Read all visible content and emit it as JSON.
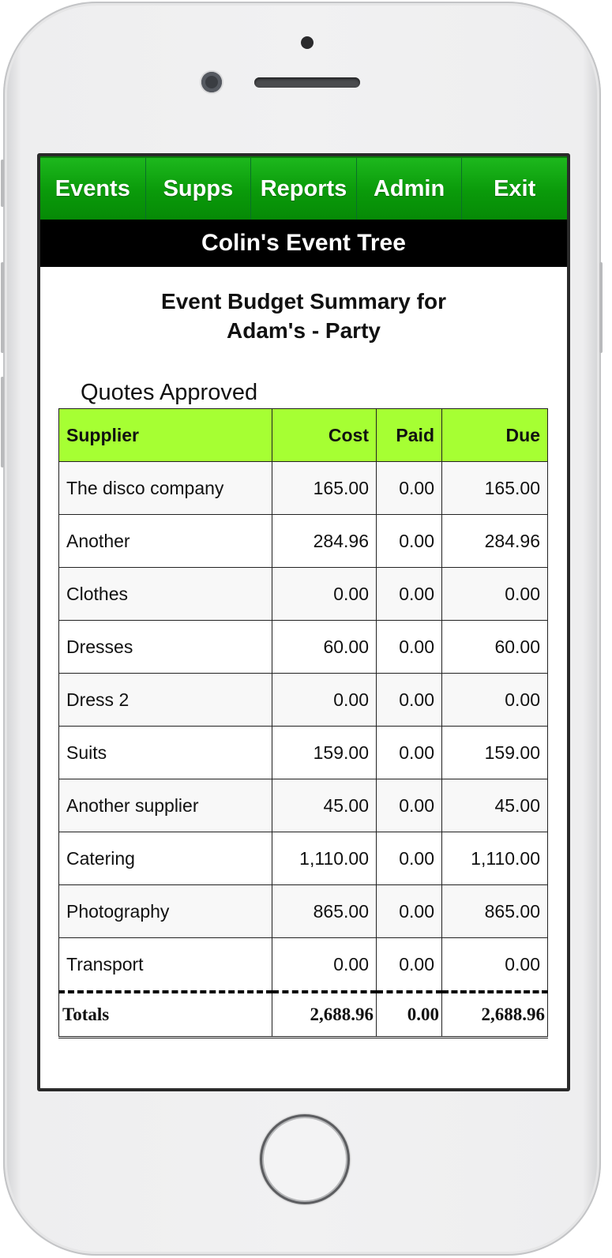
{
  "nav": {
    "items": [
      "Events",
      "Supps",
      "Reports",
      "Admin",
      "Exit"
    ]
  },
  "app_title": "Colin's Event Tree",
  "heading": {
    "line1": "Event Budget Summary for",
    "line2": "Adam's - Party"
  },
  "section_label": "Quotes Approved",
  "table": {
    "headers": [
      "Supplier",
      "Cost",
      "Paid",
      "Due"
    ],
    "rows": [
      [
        "The disco company",
        "165.00",
        "0.00",
        "165.00"
      ],
      [
        "Another",
        "284.96",
        "0.00",
        "284.96"
      ],
      [
        "Clothes",
        "0.00",
        "0.00",
        "0.00"
      ],
      [
        "Dresses",
        "60.00",
        "0.00",
        "60.00"
      ],
      [
        "Dress 2",
        "0.00",
        "0.00",
        "0.00"
      ],
      [
        "Suits",
        "159.00",
        "0.00",
        "159.00"
      ],
      [
        "Another supplier",
        "45.00",
        "0.00",
        "45.00"
      ],
      [
        "Catering",
        "1,110.00",
        "0.00",
        "1,110.00"
      ],
      [
        "Photography",
        "865.00",
        "0.00",
        "865.00"
      ],
      [
        "Transport",
        "0.00",
        "0.00",
        "0.00"
      ]
    ],
    "totals": [
      "Totals",
      "2,688.96",
      "0.00",
      "2,688.96"
    ]
  },
  "colors": {
    "nav_green": "#0a9a0a",
    "header_row_lime": "#a6ff33",
    "title_bar": "#000000"
  }
}
